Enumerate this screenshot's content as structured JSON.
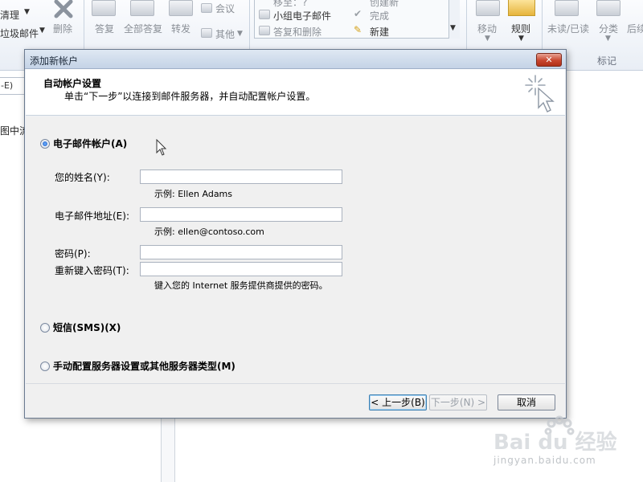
{
  "ribbon": {
    "left_labels": [
      "清理",
      "垃圾邮件"
    ],
    "delete_label": "删除",
    "reply_label": "答复",
    "reply_all_label": "全部答复",
    "forward_label": "转发",
    "meeting_label": "会议",
    "more_label": "其他",
    "quicksteps": {
      "top_cut_left": "移至：?",
      "team_email": "小组电子邮件",
      "reply_delete": "答复和删除",
      "top_cut_right": "创建新",
      "done": "完成",
      "new": "新建"
    },
    "move_label": "移动",
    "rules_label": "规则",
    "unread_label": "未读/已读",
    "categorize_label": "分类",
    "followup_label": "后续",
    "tags_group_label": "标记"
  },
  "background": {
    "search_fragment": "-E)",
    "pane_fragment": "图中流"
  },
  "dialog": {
    "title": "添加新帐户",
    "close_glyph": "✕",
    "header_title": "自动帐户设置",
    "header_desc": "单击“下一步”以连接到邮件服务器，并自动配置帐户设置。",
    "options": {
      "email": "电子邮件帐户(A)",
      "sms": "短信(SMS)(X)",
      "manual": "手动配置服务器设置或其他服务器类型(M)"
    },
    "fields": {
      "name_label": "您的姓名(Y):",
      "name_value": "",
      "name_example": "示例: Ellen Adams",
      "email_label": "电子邮件地址(E):",
      "email_value": "",
      "email_example": "示例: ellen@contoso.com",
      "password_label": "密码(P):",
      "password_value": "",
      "retype_label": "重新键入密码(T):",
      "retype_value": "",
      "password_hint": "键入您的 Internet 服务提供商提供的密码。"
    },
    "buttons": {
      "back": "< 上一步(B)",
      "next": "下一步(N) >",
      "cancel": "取消"
    }
  },
  "watermark": {
    "logo": "Bai du 经验",
    "url": "jingyan.baidu.com"
  }
}
